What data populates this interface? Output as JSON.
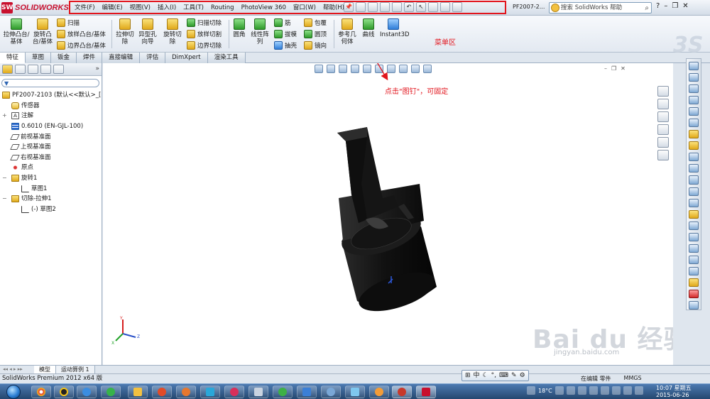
{
  "app": {
    "logo_text": "SOLIDWORKS",
    "document_title": "PF2007-2...",
    "status_text": "SolidWorks Premium 2012 x64 版"
  },
  "menu": {
    "items": [
      "文件(F)",
      "编辑(E)",
      "视图(V)",
      "插入(I)",
      "工具(T)",
      "Routing",
      "PhotoView 360",
      "窗口(W)",
      "帮助(H)"
    ],
    "annotation": "菜单区"
  },
  "help_search": {
    "placeholder": "搜索 SolidWorks 帮助"
  },
  "command_manager": {
    "extrude_boss": "拉伸凸台/基体",
    "revolve_boss": "旋转凸台/基体",
    "sweep": "扫描",
    "loft": "放样凸台/基体",
    "boundary_boss": "边界凸台/基体",
    "extrude_cut": "拉伸切除",
    "hole_wizard": "异型孔向导",
    "revolve_cut": "旋转切除",
    "swept_cut": "扫描切除",
    "lofted_cut": "放样切割",
    "boundary_cut": "边界切除",
    "fillet": "圆角",
    "linear_pattern": "线性阵列",
    "rib": "筋",
    "draft": "拔模",
    "shell": "抽壳",
    "wrap": "包覆",
    "dome": "圆顶",
    "mirror": "镜向",
    "ref_geometry": "参考几何体",
    "curves": "曲线",
    "instant3d": "Instant3D"
  },
  "tabs": [
    "特征",
    "草图",
    "钣金",
    "焊件",
    "直接编辑",
    "评估",
    "DimXpert",
    "渲染工具"
  ],
  "feature_tree": {
    "root": "PF2007-2103  (默认<<默认>_[",
    "items": [
      {
        "label": "传感器",
        "icon": "sensor-icon"
      },
      {
        "label": "注解",
        "icon": "annotation-icon"
      },
      {
        "label": "0.6010 (EN-GJL-100)",
        "icon": "material-icon"
      },
      {
        "label": "前视基准面",
        "icon": "plane-icon"
      },
      {
        "label": "上视基准面",
        "icon": "plane-icon"
      },
      {
        "label": "右视基准面",
        "icon": "plane-icon"
      },
      {
        "label": "原点",
        "icon": "origin-icon"
      },
      {
        "label": "旋转1",
        "icon": "revolve-feature-icon"
      },
      {
        "label": "草图1",
        "icon": "sketch-icon"
      },
      {
        "label": "切除-拉伸1",
        "icon": "cut-extrude-feature-icon"
      },
      {
        "label": "(-) 草图2",
        "icon": "sketch-icon"
      }
    ]
  },
  "viewport": {
    "pin_annotation": "点击\"图钉\"，可固定",
    "watermark_text": "Bai du 经验",
    "watermark_url": "jingyan.baidu.com",
    "triad_labels": {
      "x": "X",
      "y": "Y",
      "z": "Z"
    }
  },
  "bottom_tabs": [
    "模型",
    "运动算例 1"
  ],
  "status": {
    "editing": "在编辑 零件",
    "units": "MMGS"
  },
  "ime": {
    "mode": "中"
  },
  "tray": {
    "temperature": "18°C"
  },
  "clock": {
    "time": "10:07 星期五",
    "date": "2015-06-26"
  },
  "colors": {
    "accent_red": "#e2151d",
    "part_color": "#121212",
    "taskbar": "#2e5482"
  }
}
